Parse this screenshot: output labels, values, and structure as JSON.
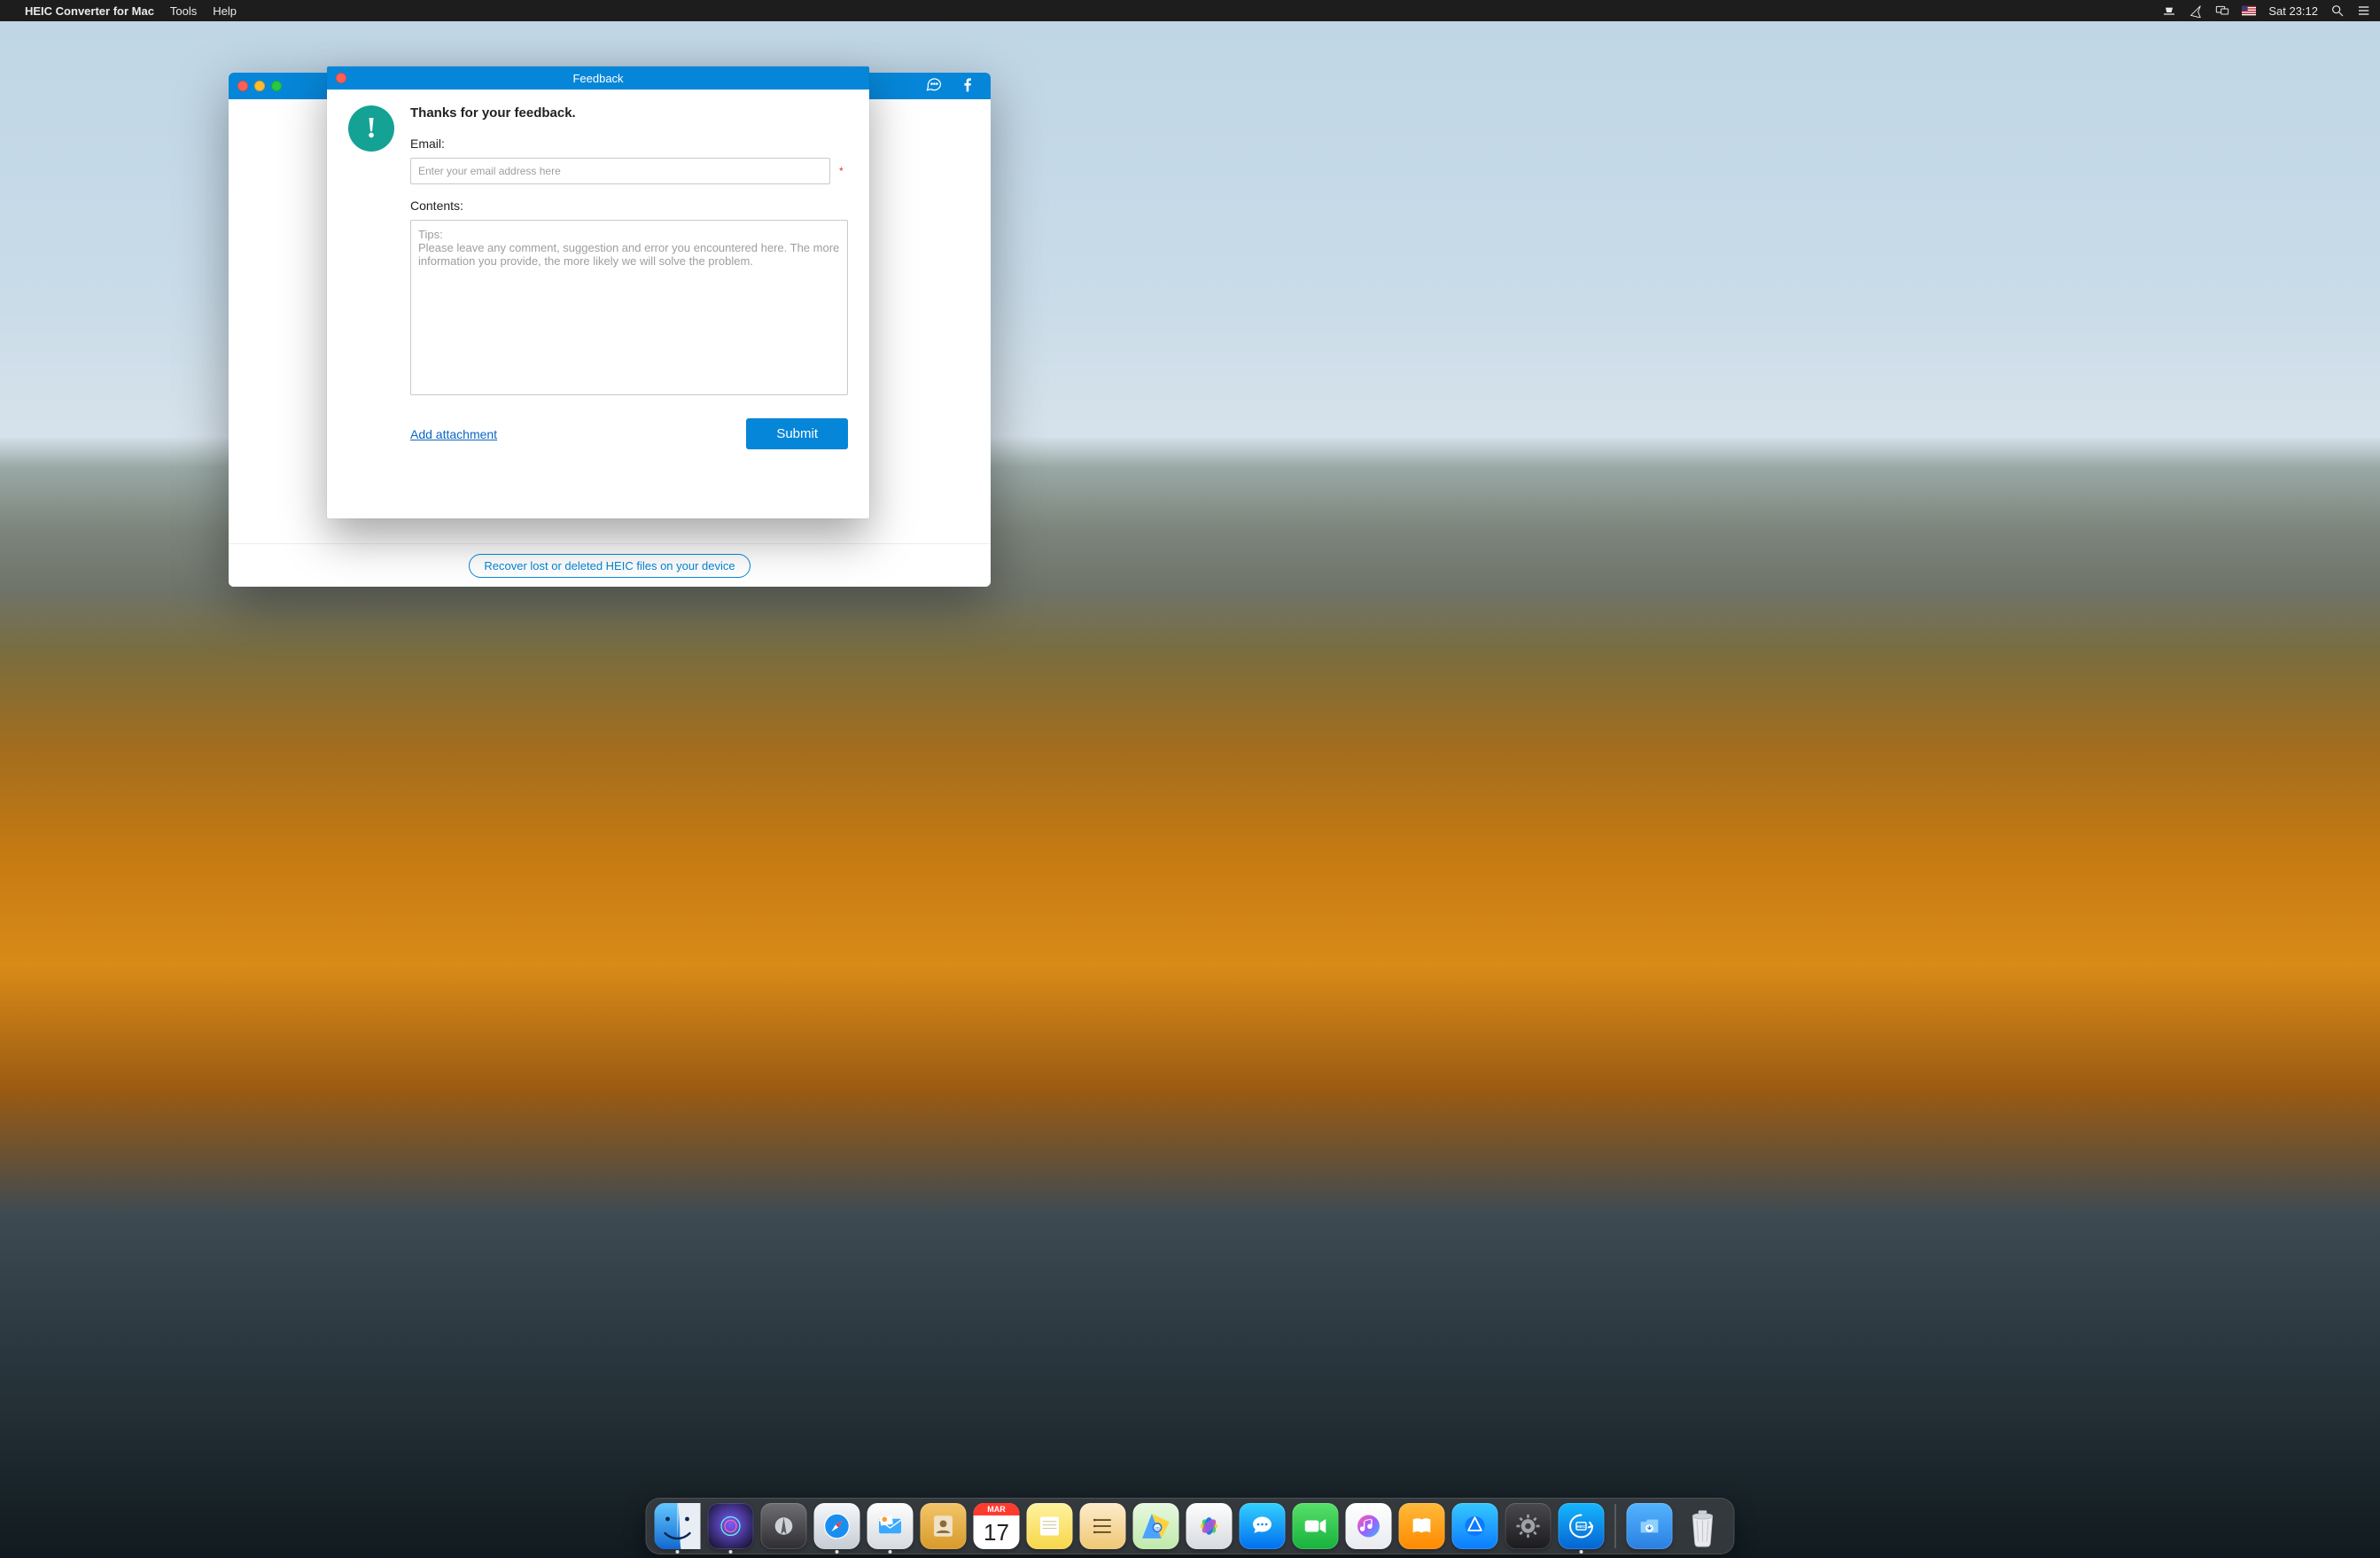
{
  "menubar": {
    "app_name": "HEIC Converter for Mac",
    "menus": [
      "Tools",
      "Help"
    ],
    "clock": "Sat 23:12"
  },
  "window": {
    "header_icons": {
      "chat": "chat-icon",
      "facebook": "facebook-icon"
    },
    "recover_link": "Recover lost or deleted HEIC files on your device"
  },
  "feedback": {
    "title": "Feedback",
    "heading": "Thanks for your feedback.",
    "email_label": "Email:",
    "email_placeholder": "Enter your email address here",
    "email_value": "",
    "required_mark": "*",
    "contents_label": "Contents:",
    "contents_placeholder": "Tips:\nPlease leave any comment, suggestion and error you encountered here. The more information you provide, the more likely we will solve the problem.",
    "contents_value": "",
    "add_attachment": "Add attachment",
    "submit": "Submit"
  },
  "dock": {
    "cal_month": "MAR",
    "cal_day": "17"
  }
}
